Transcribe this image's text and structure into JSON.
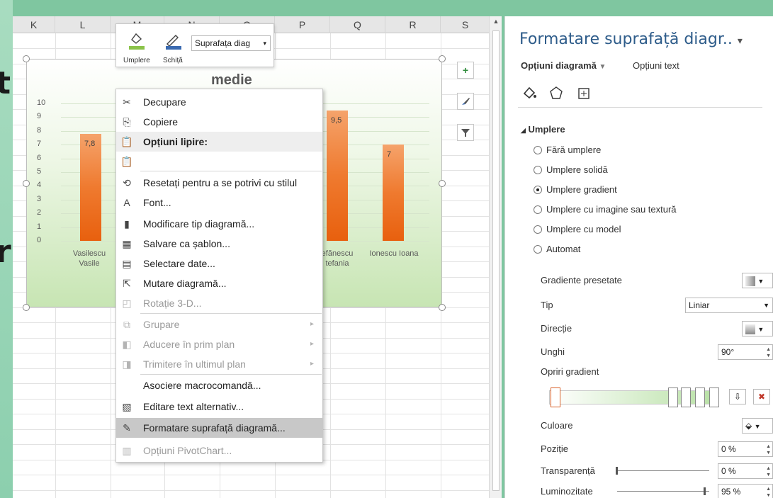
{
  "background": {
    "left_chars": [
      "t",
      "r"
    ]
  },
  "sheet": {
    "columns": [
      "K",
      "L",
      "M",
      "N",
      "O",
      "P",
      "Q",
      "R",
      "S"
    ]
  },
  "chart": {
    "title": "medie",
    "side_buttons": [
      "plus-icon",
      "brush-icon",
      "filter-icon"
    ]
  },
  "chart_data": {
    "type": "bar",
    "title": "medie",
    "categories": [
      "Vasilescu Vasile",
      "Ștefănescu Ștefania",
      "Ionescu Ioana"
    ],
    "category_labels_visible": [
      [
        "Vasilescu",
        "Vasile"
      ],
      [
        "efănescu",
        "tefania"
      ],
      [
        "Ionescu Ioana"
      ]
    ],
    "values": [
      7.8,
      9.5,
      7
    ],
    "data_labels": [
      "7,8",
      "9,5",
      "7"
    ],
    "y_ticks": [
      "0",
      "1",
      "2",
      "3",
      "4",
      "5",
      "6",
      "7",
      "8",
      "9",
      "10"
    ],
    "ylim": [
      0,
      10
    ],
    "colors": {
      "bar": "#ef7a2f",
      "background_bottom": "#c7e5b3"
    },
    "grid": true
  },
  "mini_toolbar": {
    "fill_label": "Umplere",
    "outline_label": "Schiță",
    "element_select": "Suprafața diag"
  },
  "context_menu": {
    "items": [
      {
        "icon": "scissors-icon",
        "label": "Decupare",
        "disabled": false
      },
      {
        "icon": "copy-icon",
        "label": "Copiere",
        "disabled": false
      },
      {
        "icon": "paste-icon",
        "label": "Opțiuni lipire:",
        "disabled": false
      },
      {
        "icon": "paste-icon",
        "label": "",
        "disabled": false
      },
      {
        "icon": "reset-style-icon",
        "label": "Resetați pentru a se potrivi cu stilul",
        "disabled": false
      },
      {
        "icon": "font-icon",
        "label": "Font...",
        "disabled": false
      },
      {
        "icon": "chart-type-icon",
        "label": "Modificare tip diagramă...",
        "disabled": false
      },
      {
        "icon": "save-template-icon",
        "label": "Salvare ca șablon...",
        "disabled": false
      },
      {
        "icon": "select-data-icon",
        "label": "Selectare date...",
        "disabled": false
      },
      {
        "icon": "move-chart-icon",
        "label": "Mutare diagramă...",
        "disabled": false
      },
      {
        "icon": "rotation-3d-icon",
        "label": "Rotație 3-D...",
        "disabled": true
      },
      {
        "icon": "group-icon",
        "label": "Grupare",
        "disabled": true
      },
      {
        "icon": "bring-front-icon",
        "label": "Aducere în prim plan",
        "disabled": true
      },
      {
        "icon": "send-back-icon",
        "label": "Trimitere în ultimul plan",
        "disabled": true
      },
      {
        "icon": "",
        "label": "Asociere macrocomandă...",
        "disabled": false
      },
      {
        "icon": "alt-text-icon",
        "label": "Editare text alternativ...",
        "disabled": false
      },
      {
        "icon": "format-area-icon",
        "label": "Formatare suprafață diagramă...",
        "disabled": false
      },
      {
        "icon": "pivot-options-icon",
        "label": "Opțiuni PivotChart...",
        "disabled": true
      }
    ]
  },
  "pane": {
    "title": "Formatare suprafață diagr..",
    "tab_chart": "Opțiuni diagramă",
    "tab_text": "Opțiuni text",
    "section": "Umplere",
    "fill_options": [
      {
        "label": "Fără umplere",
        "selected": false
      },
      {
        "label": "Umplere solidă",
        "selected": false
      },
      {
        "label": "Umplere gradient",
        "selected": true
      },
      {
        "label": "Umplere cu imagine sau textură",
        "selected": false
      },
      {
        "label": "Umplere cu model",
        "selected": false
      },
      {
        "label": "Automat",
        "selected": false
      }
    ],
    "props": {
      "preset_label": "Gradiente presetate",
      "type_label": "Tip",
      "type_value": "Liniar",
      "direction_label": "Direcție",
      "angle_label": "Unghi",
      "angle_value": "90°",
      "stops_label": "Opriri gradient",
      "color_label": "Culoare",
      "position_label": "Poziție",
      "position_value": "0 %",
      "transparency_label": "Transparență",
      "transparency_value": "0 %",
      "brightness_label": "Luminozitate",
      "brightness_value": "95 %"
    }
  }
}
